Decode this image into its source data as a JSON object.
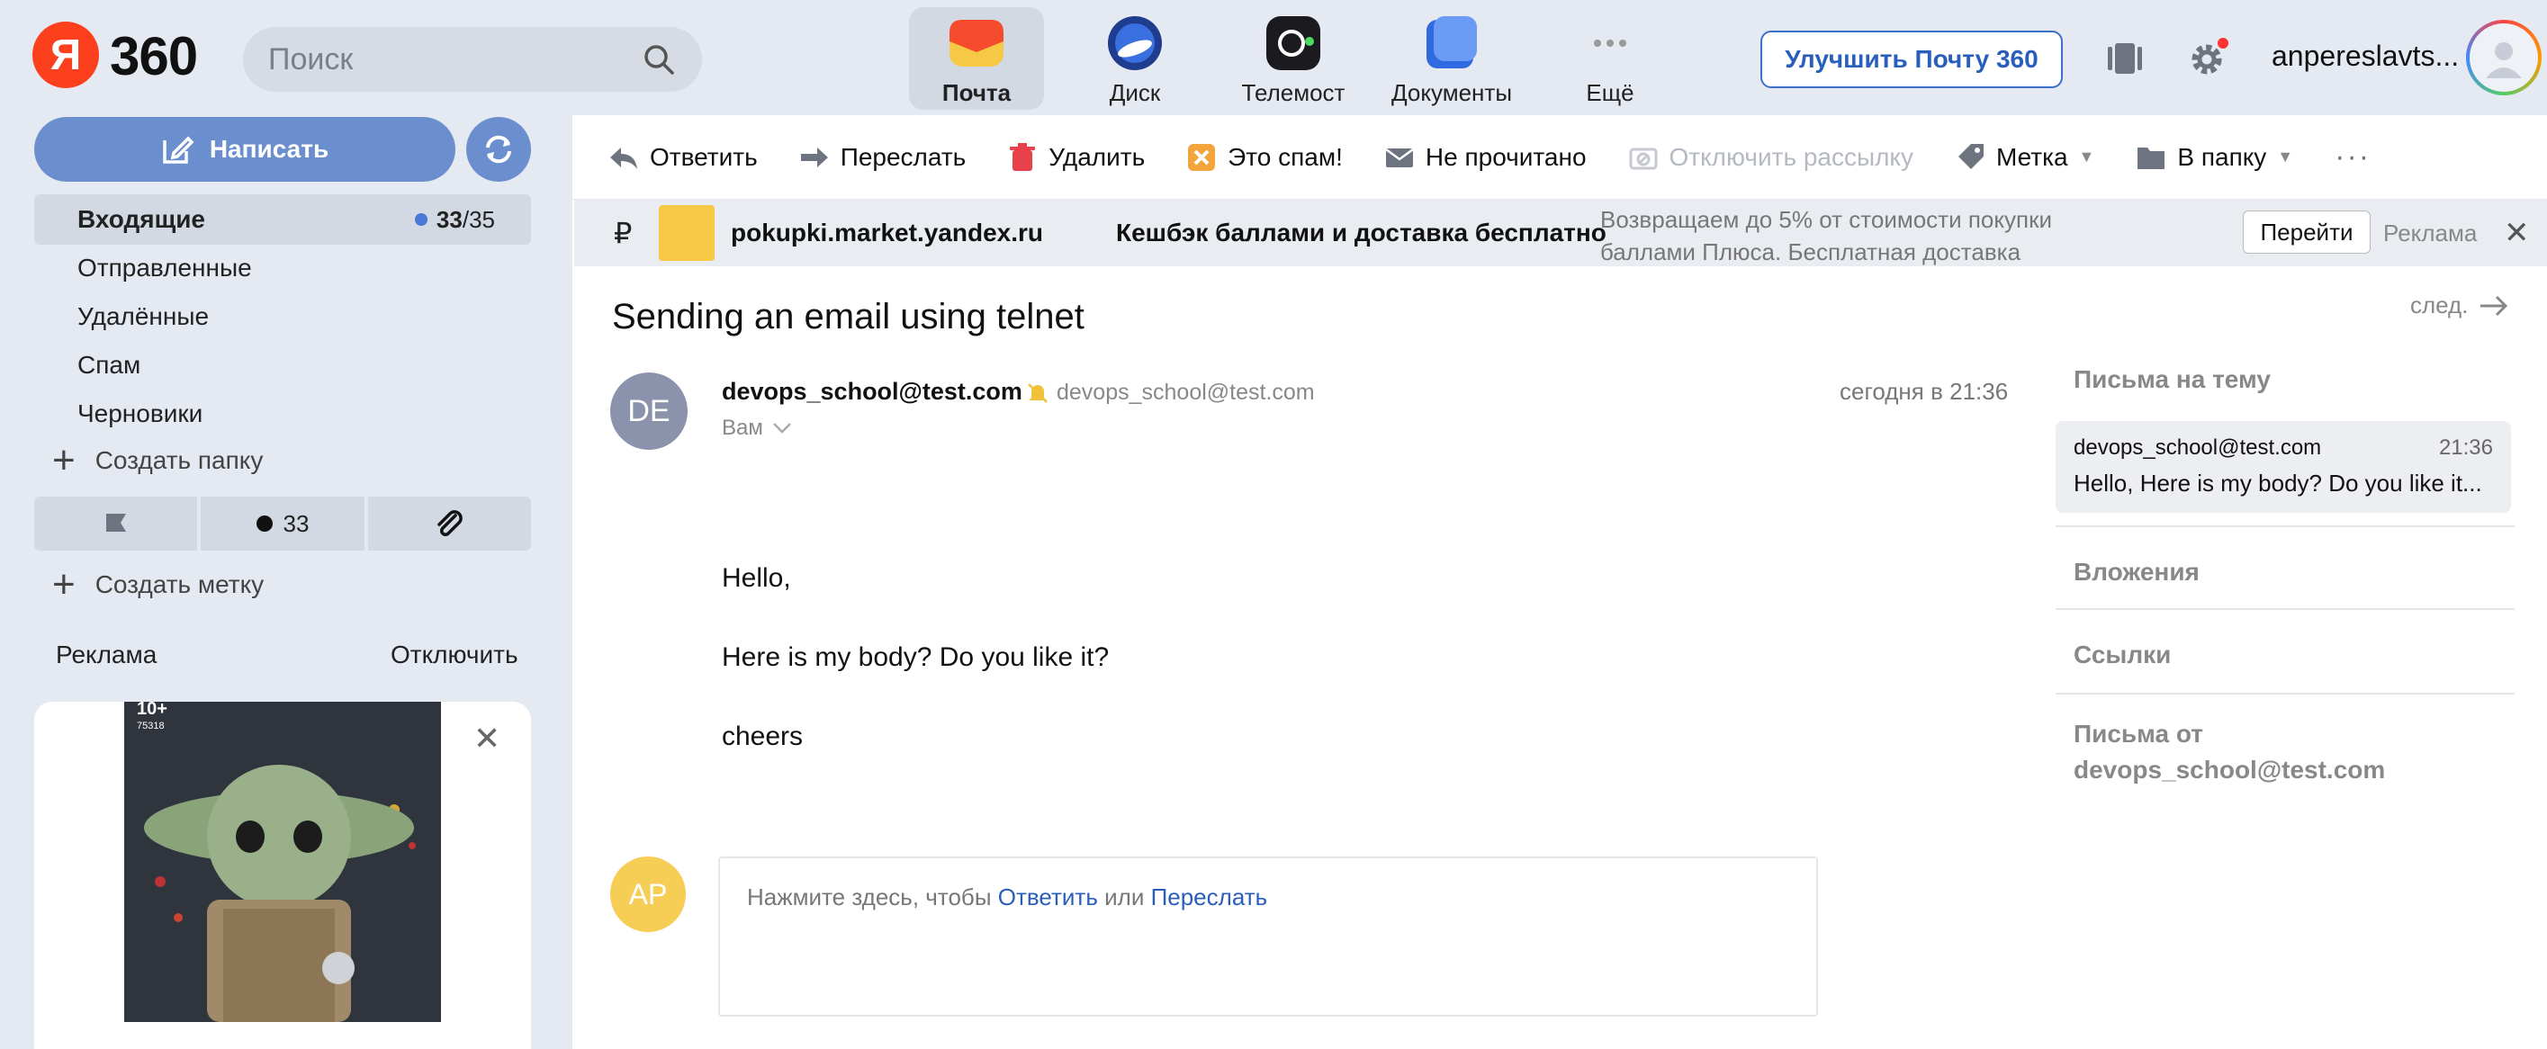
{
  "header": {
    "logo_letter": "Я",
    "logo_text": "360",
    "search_placeholder": "Поиск",
    "services": [
      {
        "label": "Почта",
        "active": true
      },
      {
        "label": "Диск",
        "active": false
      },
      {
        "label": "Телемост",
        "active": false
      },
      {
        "label": "Документы",
        "active": false
      },
      {
        "label": "Ещё",
        "active": false
      }
    ],
    "upgrade_label": "Улучшить Почту 360",
    "username": "anpereslavts..."
  },
  "sidebar": {
    "compose_label": "Написать",
    "folders": [
      {
        "label": "Входящие",
        "unread": "33",
        "total": "35",
        "active": true
      },
      {
        "label": "Отправленные"
      },
      {
        "label": "Удалённые"
      },
      {
        "label": "Спам"
      },
      {
        "label": "Черновики"
      }
    ],
    "create_folder": "Создать папку",
    "filter_unread_count": "33",
    "create_label": "Создать метку",
    "ad_label": "Реклама",
    "ad_disable": "Отключить",
    "ad_badge_age": "10+",
    "ad_badge_code": "75318"
  },
  "toolbar": {
    "reply": "Ответить",
    "forward": "Переслать",
    "delete": "Удалить",
    "spam": "Это спам!",
    "unread": "Не прочитано",
    "unsubscribe": "Отключить рассылку",
    "label": "Метка",
    "to_folder": "В папку"
  },
  "promo": {
    "currency": "₽",
    "domain": "pokupki.market.yandex.ru",
    "headline": "Кешбэк баллами и доставка бесплатно",
    "description": "Возвращаем до 5% от стоимости покупки баллами Плюса. Бесплатная доставка",
    "go_label": "Перейти",
    "ad_tag": "Реклама"
  },
  "message": {
    "subject": "Sending an email using telnet",
    "next_label": "след.",
    "sender_initials": "DE",
    "from_name": "devops_school@test.com",
    "from_addr": "devops_school@test.com",
    "date": "сегодня в 21:36",
    "to": "Вам",
    "body": [
      "Hello,",
      "Here is my body? Do you like it?",
      "cheers"
    ]
  },
  "reply": {
    "initials": "AP",
    "prompt": "Нажмите здесь, чтобы",
    "reply_link": "Ответить",
    "or": "или",
    "forward_link": "Переслать"
  },
  "rail": {
    "thread_title": "Письма на тему",
    "thread_from": "devops_school@test.com",
    "thread_time": "21:36",
    "thread_snippet": "Hello, Here is my body? Do you like it...",
    "attachments": "Вложения",
    "links": "Ссылки",
    "letters_from_title": "Письма от",
    "letters_from_addr": "devops_school@test.com"
  },
  "colors": {
    "brand_red": "#fc3f1d",
    "compose_blue": "#6b8fce",
    "link_blue": "#2a5ebc",
    "unread_dot": "#4a78d6"
  }
}
